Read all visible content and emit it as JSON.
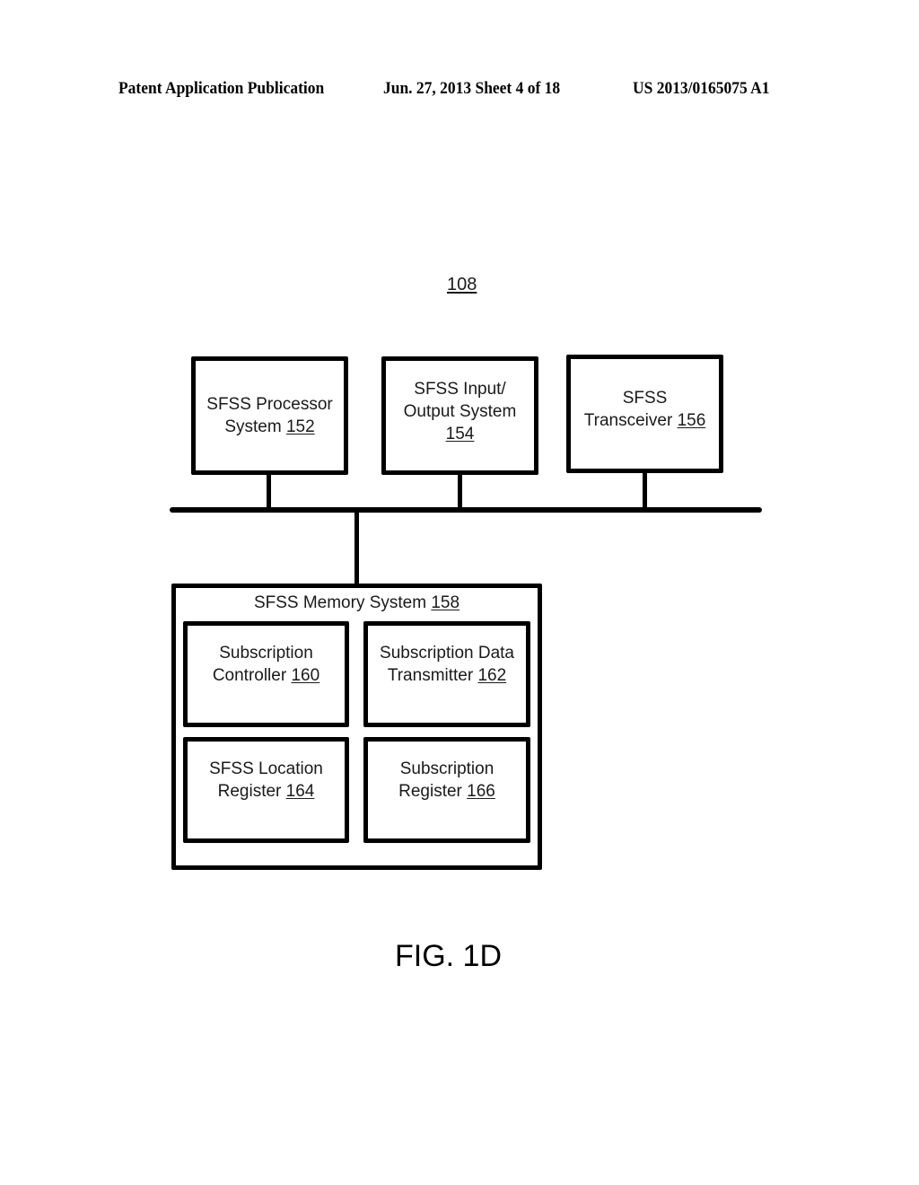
{
  "header": {
    "publication": "Patent Application Publication",
    "date_sheet": "Jun. 27, 2013  Sheet 4 of 18",
    "number": "US 2013/0165075 A1"
  },
  "diagram": {
    "ref_label": "108",
    "figure_label": "FIG. 1D",
    "top_components": [
      {
        "lines": [
          "SFSS Processor",
          "System "
        ],
        "ref": "152"
      },
      {
        "lines": [
          "SFSS Input/",
          "Output System",
          ""
        ],
        "ref": "154"
      },
      {
        "lines": [
          "SFSS",
          "Transceiver "
        ],
        "ref": "156"
      }
    ],
    "memory_system": {
      "title": "SFSS Memory System ",
      "ref": "158",
      "components": [
        {
          "lines": [
            "Subscription",
            "Controller "
          ],
          "ref": "160"
        },
        {
          "lines": [
            "Subscription Data",
            "Transmitter "
          ],
          "ref": "162"
        },
        {
          "lines": [
            "SFSS Location",
            "Register "
          ],
          "ref": "164"
        },
        {
          "lines": [
            "Subscription",
            "Register "
          ],
          "ref": "166"
        }
      ]
    },
    "connections": [
      {
        "from": "152",
        "to": "bus"
      },
      {
        "from": "154",
        "to": "bus"
      },
      {
        "from": "156",
        "to": "bus"
      },
      {
        "from": "bus",
        "to": "158"
      }
    ]
  }
}
